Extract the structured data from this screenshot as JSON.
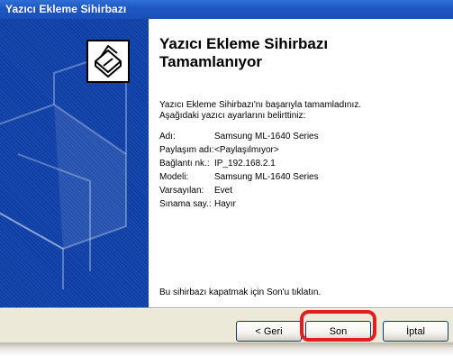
{
  "window": {
    "title": "Yazıcı Ekleme Sihirbazı"
  },
  "content": {
    "heading_line1": "Yazıcı Ekleme Sihirbazı",
    "heading_line2": "Tamamlanıyor",
    "intro_line1": "Yazıcı Ekleme Sihirbazı'nı başarıyla tamamladınız.",
    "intro_line2": "Aşağıdaki yazıcı ayarlarını belirttiniz:",
    "details": [
      {
        "label": "Adı:",
        "value": "Samsung ML-1640 Series"
      },
      {
        "label": "Paylaşım adı:",
        "value": "<Paylaşılmıyor>"
      },
      {
        "label": "Bağlantı nk.:",
        "value": "IP_192.168.2.1"
      },
      {
        "label": "Modeli:",
        "value": "Samsung ML-1640 Series"
      },
      {
        "label": "Varsayılan:",
        "value": "Evet"
      },
      {
        "label": "Sınama say.:",
        "value": "Hayır"
      }
    ],
    "finish_note": "Bu sihirbazı kapatmak için Son'u tıklatın."
  },
  "buttons": {
    "back": "< Geri",
    "finish": "Son",
    "cancel": "İptal"
  },
  "colors": {
    "titlebar": "#1f56c2",
    "side_panel": "#0e3fa6",
    "button_bar": "#ece9d8",
    "highlight": "#e02020"
  },
  "icons": {
    "wizard": "printer-icon"
  }
}
